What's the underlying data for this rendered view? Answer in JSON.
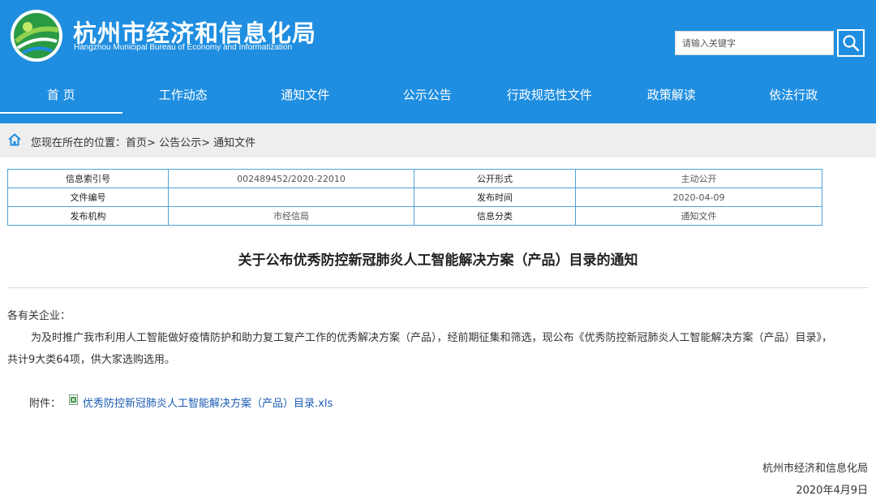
{
  "header": {
    "title": "杭州市经济和信息化局",
    "subtitle": "Hangzhou Municipal Bureau of Economy and Informatization",
    "logo_icon": "globe-leaf-logo",
    "search": {
      "placeholder": "请输入关键字",
      "button_icon": "search-icon"
    },
    "colors": {
      "header_bg": "#1f8ee0",
      "breadcrumb_bg": "#eeeeee",
      "table_border": "#4fa3d9",
      "link": "#1a5bb4"
    }
  },
  "nav": {
    "items": [
      {
        "label": "首 页"
      },
      {
        "label": "工作动态"
      },
      {
        "label": "通知文件"
      },
      {
        "label": "公示公告"
      },
      {
        "label": "行政规范性文件"
      },
      {
        "label": "政策解读"
      },
      {
        "label": "依法行政"
      }
    ],
    "active_index": 0
  },
  "breadcrumb": {
    "icon": "home-icon",
    "prefix": "您现在所在的位置：",
    "items": [
      "首页",
      "公告公示",
      "通知文件"
    ],
    "separator": ">"
  },
  "info_table": {
    "rows": [
      [
        {
          "label": "信息索引号",
          "value": "002489452/2020-22010"
        },
        {
          "label": "公开形式",
          "value": "主动公开"
        }
      ],
      [
        {
          "label": "文件编号",
          "value": ""
        },
        {
          "label": "发布时间",
          "value": "2020-04-09"
        }
      ],
      [
        {
          "label": "发布机构",
          "value": "市经信局"
        },
        {
          "label": "信息分类",
          "value": "通知文件"
        }
      ]
    ]
  },
  "article": {
    "title": "关于公布优秀防控新冠肺炎人工智能解决方案（产品）目录的通知",
    "salutation": "各有关企业：",
    "body_line1": "为及时推广我市利用人工智能做好疫情防护和助力复工复产工作的优秀解决方案（产品），经前期征集和筛选，现公布《优秀防控新冠肺炎人工智能解决方案（产品）目录》，",
    "body_line2": "共计9大类64项，供大家选购选用。",
    "attachment_label": "附件：",
    "attachment_icon": "xls-file-icon",
    "attachment_link": "优秀防控新冠肺炎人工智能解决方案（产品）目录.xls",
    "signature_org": "杭州市经济和信息化局",
    "signature_date": "2020年4月9日"
  }
}
